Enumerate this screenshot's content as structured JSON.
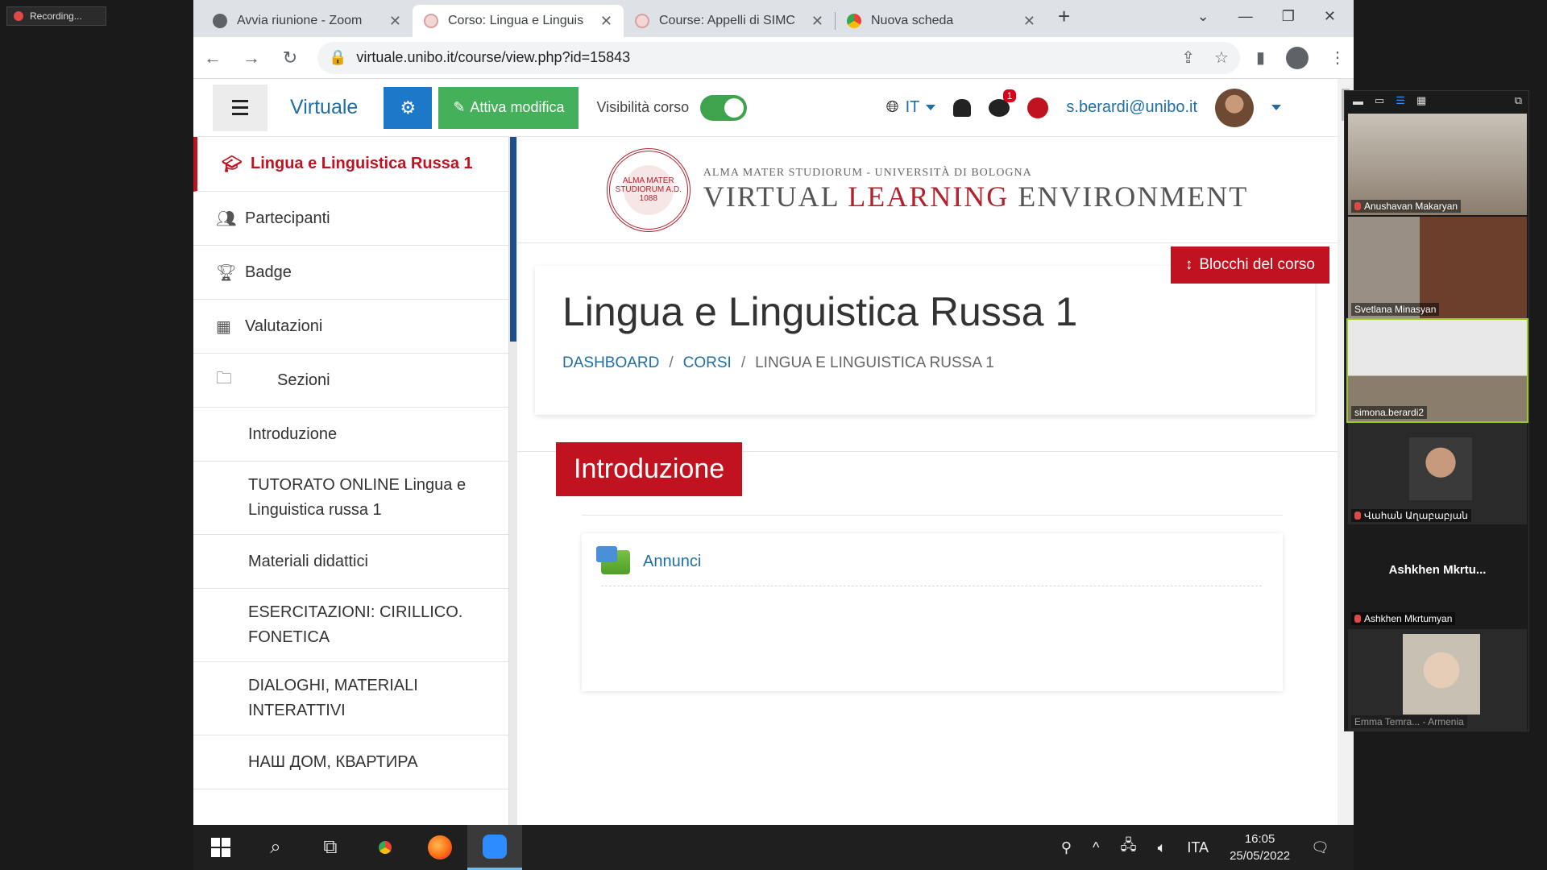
{
  "recording": {
    "label": "Recording..."
  },
  "browser": {
    "tabs": [
      {
        "title": "Avvia riunione - Zoom",
        "favicon": "globe-icon",
        "active": false
      },
      {
        "title": "Corso: Lingua e Linguis",
        "favicon": "unibo-icon",
        "active": true
      },
      {
        "title": "Course: Appelli di SIMC",
        "favicon": "unibo-icon",
        "active": false
      },
      {
        "title": "Nuova scheda",
        "favicon": "chrome-icon",
        "active": false
      }
    ],
    "newtab": "+",
    "url": "virtuale.unibo.it/course/view.php?id=15843"
  },
  "moodle_nav": {
    "brand": "Virtuale",
    "edit_button": "Attiva modifica",
    "visibility_label": "Visibilità corso",
    "visibility_on": true,
    "language": "IT",
    "notification_count": "1",
    "user_email": "s.berardi@unibo.it"
  },
  "drawer": {
    "current_course": "Lingua e Linguistica Russa 1",
    "main_items": [
      {
        "label": "Partecipanti",
        "icon": "users-icon"
      },
      {
        "label": "Badge",
        "icon": "trophy-icon"
      },
      {
        "label": "Valutazioni",
        "icon": "table-icon"
      },
      {
        "label": "Sezioni",
        "icon": "folder-icon"
      }
    ],
    "sections": [
      "Introduzione",
      "TUTORATO ONLINE Lingua e Linguistica russa 1",
      "Materiali didattici",
      "ESERCITAZIONI: CIRILLICO. FONETICA",
      "DIALOGHI, MATERIALI INTERATTIVI",
      "НАШ ДОМ, КВАРТИРА"
    ]
  },
  "content": {
    "banner_top": "ALMA MATER STUDIORUM - UNIVERSITÀ DI BOLOGNA",
    "banner_main_1": "VIRTUAL ",
    "banner_main_2": "LEARNING",
    "banner_main_3": " ENVIRONMENT",
    "seal_text": "ALMA MATER STUDIORUM A.D. 1088",
    "blocks_button": "Blocchi del corso",
    "page_title": "Lingua e Linguistica Russa 1",
    "breadcrumb": {
      "dashboard": "DASHBOARD",
      "corsi": "CORSI",
      "current": "LINGUA E LINGUISTICA RUSSA 1",
      "sep": "/"
    },
    "section_title": "Introduzione",
    "activity": "Annunci"
  },
  "taskbar": {
    "time": "16:05",
    "date": "25/05/2022",
    "lang": "ITA"
  },
  "zoom": {
    "participants": [
      {
        "name": "Anushavan Makaryan",
        "muted": true
      },
      {
        "name": "Svetlana Minasyan",
        "muted": false
      },
      {
        "name": "simona.berardi2",
        "muted": false
      },
      {
        "name": "Վահան Աղաբաբյան",
        "muted": true
      },
      {
        "name": "Ashkhen Mkrtumyan",
        "display": "Ashkhen  Mkrtu...",
        "muted": true
      },
      {
        "name": "Emma Temra... - Armenia",
        "muted": true
      }
    ]
  },
  "colors": {
    "unibo_red": "#c1121f",
    "link_blue": "#1f6ea3",
    "edit_green": "#44b05a",
    "zoom_blue": "#2d8cff"
  }
}
